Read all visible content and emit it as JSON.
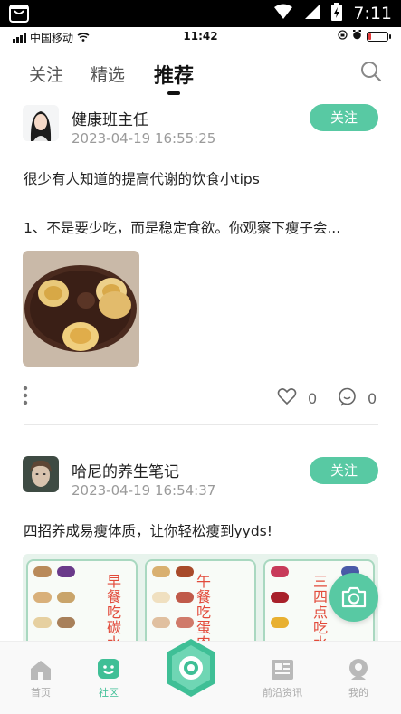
{
  "system_status": {
    "time": "7:11",
    "icons": [
      "android-app-icon",
      "wifi-icon",
      "signal-icon",
      "battery-charging-icon"
    ]
  },
  "phone_status": {
    "carrier": "中国移动",
    "time": "11:42",
    "battery_level": 0.15
  },
  "top_tabs": {
    "items": [
      {
        "label": "关注"
      },
      {
        "label": "精选"
      },
      {
        "label": "推荐"
      }
    ],
    "active": "推荐"
  },
  "feed": {
    "posts": [
      {
        "author": "健康班主任",
        "datetime": "2023-04-19 16:55:25",
        "follow_label": "关注",
        "title": "很少有人知道的提高代谢的饮食小tips",
        "excerpt": "1、不是要少吃，而是稳定食欲。你观察下瘦子会...",
        "likes": "0",
        "comments": "0"
      },
      {
        "author": "哈尼的养生笔记",
        "datetime": "2023-04-19 16:54:37",
        "follow_label": "关注",
        "title": "四招养成易瘦体质，让你轻松瘦到yyds!",
        "panels": [
          {
            "heading": "早餐吃碳水"
          },
          {
            "heading": "午餐吃蛋肉"
          },
          {
            "heading": "三四点吃水"
          }
        ]
      }
    ]
  },
  "bottom_nav": {
    "items": [
      {
        "label": "首页",
        "icon": "home-icon"
      },
      {
        "label": "社区",
        "icon": "community-icon"
      },
      {
        "label": "",
        "icon": "center-ring-icon"
      },
      {
        "label": "前沿资讯",
        "icon": "news-icon"
      },
      {
        "label": "我的",
        "icon": "profile-icon"
      }
    ],
    "active": "社区"
  },
  "colors": {
    "accent": "#58c9a3",
    "accent_dark": "#3fbf96",
    "text": "#222222",
    "muted": "#9a9a9a"
  }
}
